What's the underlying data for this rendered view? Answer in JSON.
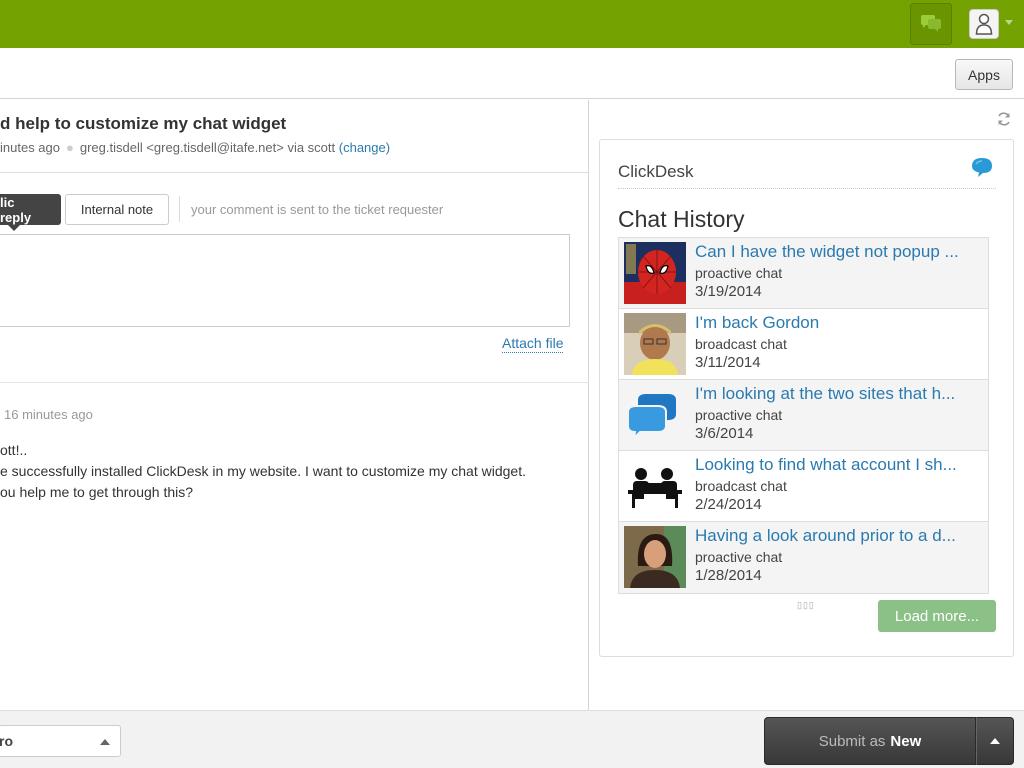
{
  "header": {
    "accent_color": "#74a200",
    "chat_icon": "chat-bubbles-icon",
    "user_icon": "user-avatar-icon"
  },
  "toolbar": {
    "apps_label": "Apps"
  },
  "ticket": {
    "subject": "d help to customize my chat widget",
    "time_ago": "inutes ago",
    "requester": "greg.tisdell <greg.tisdell@itafe.net> via scott",
    "change_link": "(change)"
  },
  "composer": {
    "public_reply_label": "lic reply",
    "internal_note_label": "Internal note",
    "hint": "your comment is sent to the ticket requester",
    "attach_label": "Attach file"
  },
  "comment": {
    "time": "16 minutes ago",
    "body": "ott!..\ne successfully installed ClickDesk in my website. I want to customize my chat widget.\nou help me to get through this?"
  },
  "widget": {
    "title": "ClickDesk",
    "history_title": "Chat History",
    "chats": [
      {
        "title": "Can I have the widget not popup ...",
        "type": "proactive chat",
        "date": "3/19/2014"
      },
      {
        "title": "I'm back Gordon",
        "type": "broadcast chat",
        "date": "3/11/2014"
      },
      {
        "title": "I'm looking at the two sites that h...",
        "type": "proactive chat",
        "date": "3/6/2014"
      },
      {
        "title": "Looking to find what account I sh...",
        "type": "broadcast chat",
        "date": "2/24/2014"
      },
      {
        "title": "Having a look around prior to a d...",
        "type": "proactive chat",
        "date": "1/28/2014"
      }
    ],
    "load_more_label": "Load more..."
  },
  "footer": {
    "status_value": "ro",
    "submit_prefix": "Submit as",
    "submit_status": "New"
  }
}
